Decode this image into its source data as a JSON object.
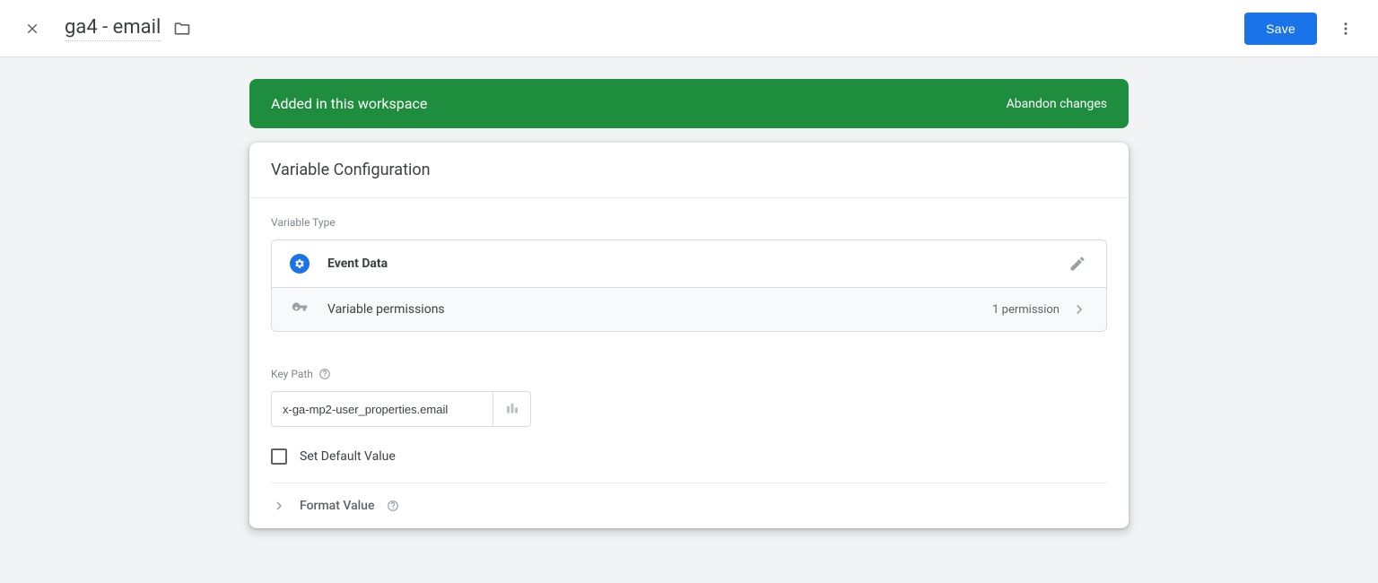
{
  "header": {
    "title": "ga4 - email",
    "save_label": "Save"
  },
  "banner": {
    "message": "Added in this workspace",
    "action_label": "Abandon changes"
  },
  "card": {
    "title": "Variable Configuration",
    "variable_type_label": "Variable Type",
    "type_name": "Event Data",
    "permissions_label": "Variable permissions",
    "permissions_count": "1 permission",
    "key_path_label": "Key Path",
    "key_path_value": "x-ga-mp2-user_properties.email",
    "set_default_label": "Set Default Value",
    "format_value_label": "Format Value"
  }
}
